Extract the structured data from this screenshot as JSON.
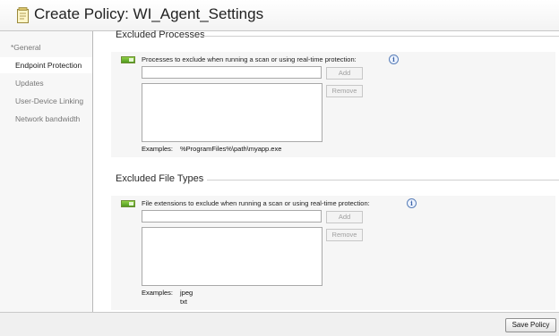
{
  "window": {
    "title": "Create Policy: WI_Agent_Settings",
    "icon": "policy-document-icon"
  },
  "sidebar": {
    "items": [
      {
        "label": "*General",
        "active": false
      },
      {
        "label": "Endpoint Protection",
        "active": true
      },
      {
        "label": "Updates",
        "active": false
      },
      {
        "label": "User-Device Linking",
        "active": false
      },
      {
        "label": "Network bandwidth",
        "active": false
      }
    ]
  },
  "excluded_processes": {
    "title": "Excluded Processes",
    "label": "Processes to exclude when running a scan or using real-time protection:",
    "input_value": "",
    "add_label": "Add",
    "remove_label": "Remove",
    "examples_label": "Examples:",
    "examples": "%ProgramFiles%\\path\\myapp.exe"
  },
  "excluded_file_types": {
    "title": "Excluded File Types",
    "label": "File extensions to exclude when running a scan or using real-time protection:",
    "input_value": "",
    "add_label": "Add",
    "remove_label": "Remove",
    "examples_label": "Examples:",
    "examples": [
      "jpeg",
      "txt"
    ]
  },
  "footer": {
    "save_label": "Save Policy"
  },
  "colors": {
    "toggle_on": "#5fae2a",
    "info": "#3d64a8"
  }
}
